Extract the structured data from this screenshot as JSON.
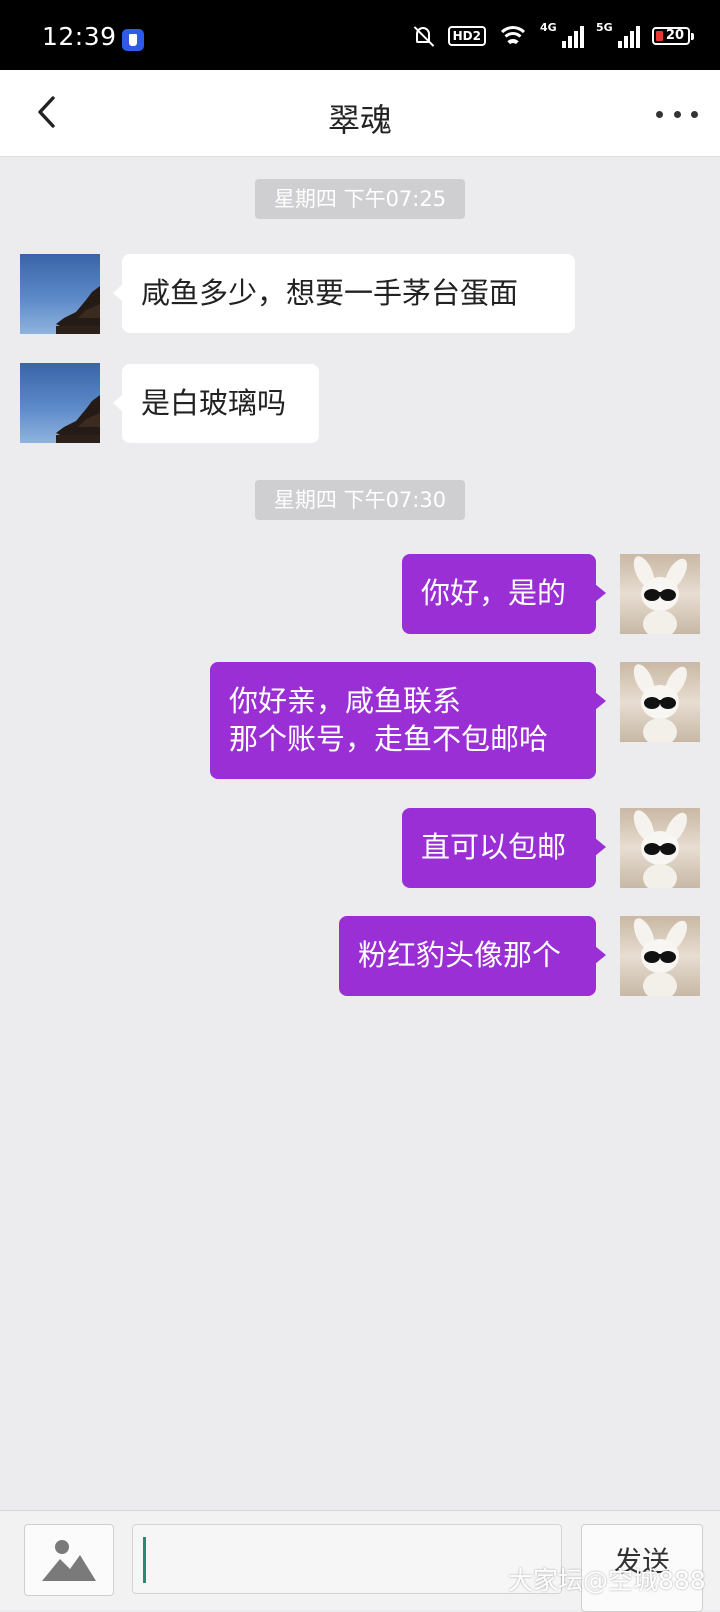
{
  "status_bar": {
    "time": "12:39",
    "hd_label": "HD2",
    "network_1": "4G",
    "network_2": "5G",
    "battery_level": "20"
  },
  "header": {
    "title": "翠魂"
  },
  "messages": {
    "divider_1": "星期四 下午07:25",
    "m1": "咸鱼多少，想要一手茅台蛋面",
    "m2": "是白玻璃吗",
    "divider_2": "星期四 下午07:30",
    "m3": "你好，是的",
    "m4_line1": "你好亲，咸鱼联系",
    "m4_line2": "那个账号，走鱼不包邮哈",
    "m5": "直可以包邮",
    "m6": "粉红豹头像那个"
  },
  "composer": {
    "send_label": "发送"
  },
  "watermark": "大家坛@空城888",
  "colors": {
    "outgoing_bubble": "#9b2fd6",
    "incoming_bubble": "#ffffff",
    "background": "#ececee"
  }
}
